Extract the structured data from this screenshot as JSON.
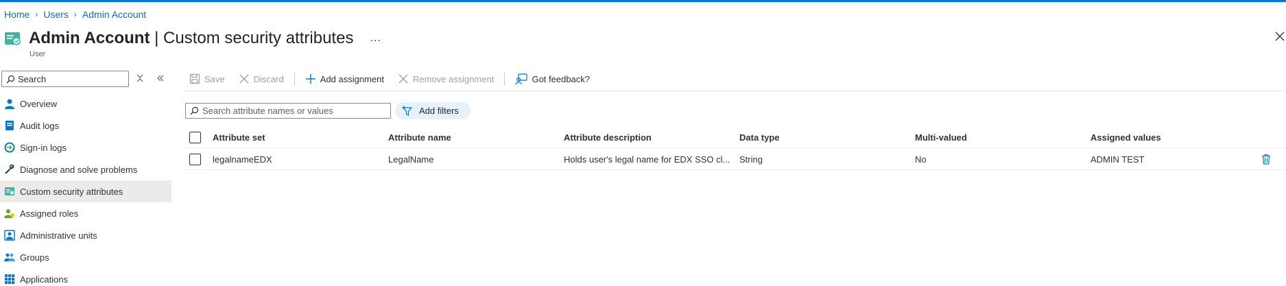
{
  "breadcrumb": {
    "home": "Home",
    "users": "Users",
    "current": "Admin Account"
  },
  "header": {
    "name": "Admin Account",
    "divider": "|",
    "section": "Custom security attributes",
    "more": "...",
    "subtitle": "User"
  },
  "sidebar": {
    "search_placeholder": "Search",
    "items": [
      {
        "label": "Overview",
        "icon": "person-icon"
      },
      {
        "label": "Audit logs",
        "icon": "audit-log-icon"
      },
      {
        "label": "Sign-in logs",
        "icon": "sign-in-icon"
      },
      {
        "label": "Diagnose and solve problems",
        "icon": "wrench-icon"
      },
      {
        "label": "Custom security attributes",
        "icon": "security-attributes-icon",
        "active": true
      },
      {
        "label": "Assigned roles",
        "icon": "roles-icon"
      },
      {
        "label": "Administrative units",
        "icon": "admin-units-icon"
      },
      {
        "label": "Groups",
        "icon": "groups-icon"
      },
      {
        "label": "Applications",
        "icon": "applications-icon"
      }
    ]
  },
  "toolbar": {
    "save": "Save",
    "discard": "Discard",
    "add_assignment": "Add assignment",
    "remove_assignment": "Remove assignment",
    "feedback": "Got feedback?"
  },
  "filters": {
    "search_placeholder": "Search attribute names or values",
    "add_filters": "Add filters"
  },
  "table": {
    "columns": [
      "Attribute set",
      "Attribute name",
      "Attribute description",
      "Data type",
      "Multi-valued",
      "Assigned values"
    ],
    "rows": [
      [
        "legalnameEDX",
        "LegalName",
        "Holds user's legal name for EDX SSO cl...",
        "String",
        "No",
        "ADMIN TEST"
      ]
    ]
  },
  "colors": {
    "accent": "#0078d4",
    "link": "#0f6cbd",
    "active_nav": "#edebe9",
    "filter_pill": "#e5f1fb"
  }
}
